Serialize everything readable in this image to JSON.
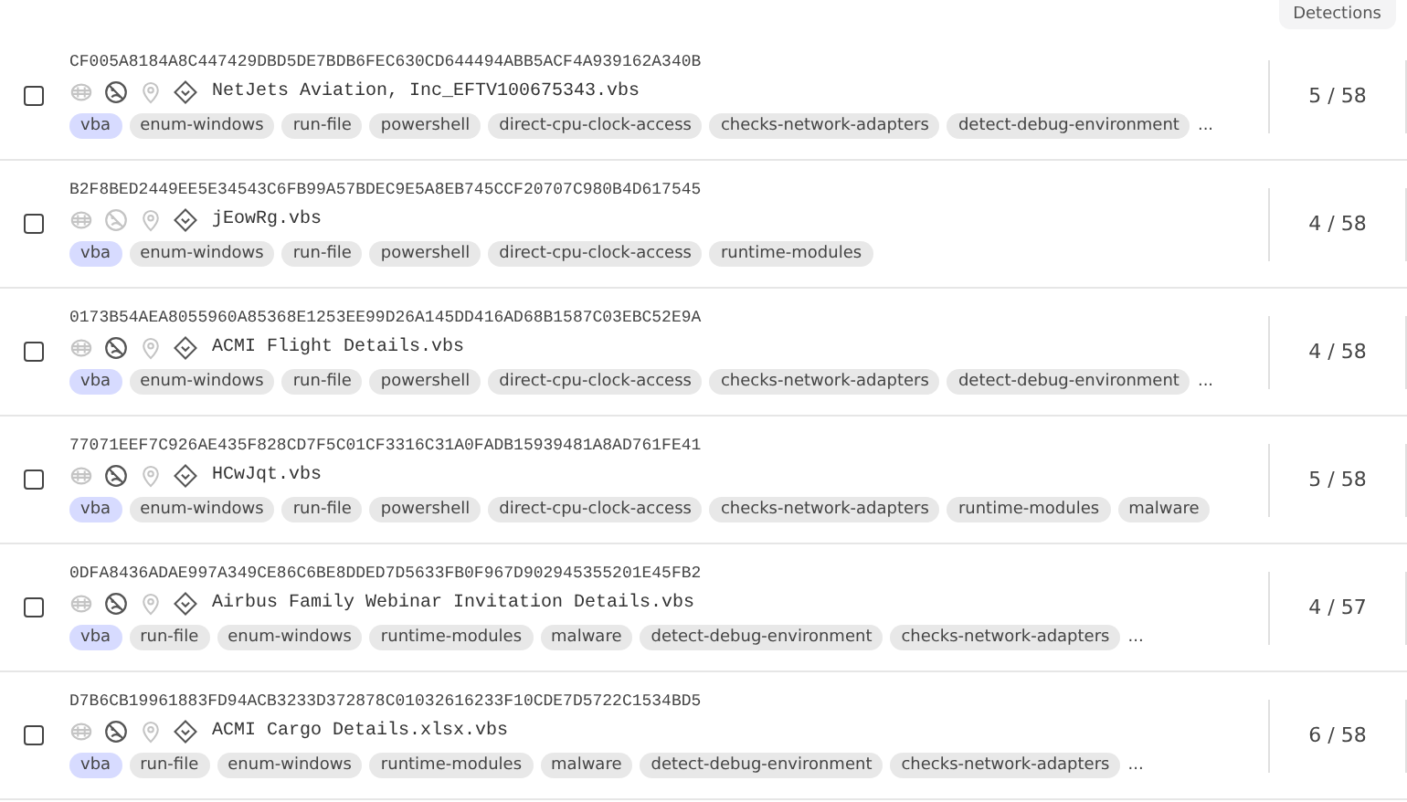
{
  "header": {
    "detections_label": "Detections"
  },
  "rows": [
    {
      "selected": false,
      "hash": "CF005A8184A8C447429DBD5DE7BDB6FEC630CD644494ABB5ACF4A939162A340B",
      "indicators": [
        {
          "kind": "embed",
          "on": false
        },
        {
          "kind": "face",
          "on": true
        },
        {
          "kind": "pin",
          "on": false
        },
        {
          "kind": "diamond",
          "on": true
        }
      ],
      "name": "NetJets Aviation, Inc_EFTV100675343.vbs",
      "tags": [
        {
          "label": "vba",
          "kind": "language"
        },
        {
          "label": "enum-windows",
          "kind": "tag"
        },
        {
          "label": "run-file",
          "kind": "tag"
        },
        {
          "label": "powershell",
          "kind": "tag"
        },
        {
          "label": "direct-cpu-clock-access",
          "kind": "tag"
        },
        {
          "label": "checks-network-adapters",
          "kind": "tag"
        },
        {
          "label": "detect-debug-environment",
          "kind": "tag"
        }
      ],
      "more": "...",
      "detections": "5 / 58"
    },
    {
      "selected": false,
      "hash": "B2F8BED2449EE5E34543C6FB99A57BDEC9E5A8EB745CCF20707C980B4D617545",
      "indicators": [
        {
          "kind": "embed",
          "on": false
        },
        {
          "kind": "face",
          "on": false
        },
        {
          "kind": "pin",
          "on": false
        },
        {
          "kind": "diamond",
          "on": true
        }
      ],
      "name": "jEowRg.vbs",
      "tags": [
        {
          "label": "vba",
          "kind": "language"
        },
        {
          "label": "enum-windows",
          "kind": "tag"
        },
        {
          "label": "run-file",
          "kind": "tag"
        },
        {
          "label": "powershell",
          "kind": "tag"
        },
        {
          "label": "direct-cpu-clock-access",
          "kind": "tag"
        },
        {
          "label": "runtime-modules",
          "kind": "tag"
        }
      ],
      "detections": "4 / 58"
    },
    {
      "selected": false,
      "hash": "0173B54AEA8055960A85368E1253EE99D26A145DD416AD68B1587C03EBC52E9A",
      "indicators": [
        {
          "kind": "embed",
          "on": false
        },
        {
          "kind": "face",
          "on": true
        },
        {
          "kind": "pin",
          "on": false
        },
        {
          "kind": "diamond",
          "on": true
        }
      ],
      "name": "ACMI Flight Details.vbs",
      "tags": [
        {
          "label": "vba",
          "kind": "language"
        },
        {
          "label": "enum-windows",
          "kind": "tag"
        },
        {
          "label": "run-file",
          "kind": "tag"
        },
        {
          "label": "powershell",
          "kind": "tag"
        },
        {
          "label": "direct-cpu-clock-access",
          "kind": "tag"
        },
        {
          "label": "checks-network-adapters",
          "kind": "tag"
        },
        {
          "label": "detect-debug-environment",
          "kind": "tag"
        }
      ],
      "more": "...",
      "detections": "4 / 58"
    },
    {
      "selected": false,
      "hash": "77071EEF7C926AE435F828CD7F5C01CF3316C31A0FADB15939481A8AD761FE41",
      "indicators": [
        {
          "kind": "embed",
          "on": false
        },
        {
          "kind": "face",
          "on": true
        },
        {
          "kind": "pin",
          "on": false
        },
        {
          "kind": "diamond",
          "on": true
        }
      ],
      "name": "HCwJqt.vbs",
      "tags": [
        {
          "label": "vba",
          "kind": "language"
        },
        {
          "label": "enum-windows",
          "kind": "tag"
        },
        {
          "label": "run-file",
          "kind": "tag"
        },
        {
          "label": "powershell",
          "kind": "tag"
        },
        {
          "label": "direct-cpu-clock-access",
          "kind": "tag"
        },
        {
          "label": "checks-network-adapters",
          "kind": "tag"
        },
        {
          "label": "runtime-modules",
          "kind": "tag"
        },
        {
          "label": "malware",
          "kind": "tag"
        }
      ],
      "detections": "5 / 58"
    },
    {
      "selected": false,
      "hash": "0DFA8436ADAE997A349CE86C6BE8DDED7D5633FB0F967D902945355201E45FB2",
      "indicators": [
        {
          "kind": "embed",
          "on": false
        },
        {
          "kind": "face",
          "on": true
        },
        {
          "kind": "pin",
          "on": false
        },
        {
          "kind": "diamond",
          "on": true
        }
      ],
      "name": "Airbus Family Webinar Invitation Details.vbs",
      "tags": [
        {
          "label": "vba",
          "kind": "language"
        },
        {
          "label": "run-file",
          "kind": "tag"
        },
        {
          "label": "enum-windows",
          "kind": "tag"
        },
        {
          "label": "runtime-modules",
          "kind": "tag"
        },
        {
          "label": "malware",
          "kind": "tag"
        },
        {
          "label": "detect-debug-environment",
          "kind": "tag"
        },
        {
          "label": "checks-network-adapters",
          "kind": "tag"
        }
      ],
      "more": "...",
      "detections": "4 / 57"
    },
    {
      "selected": false,
      "hash": "D7B6CB19961883FD94ACB3233D372878C01032616233F10CDE7D5722C1534BD5",
      "indicators": [
        {
          "kind": "embed",
          "on": false
        },
        {
          "kind": "face",
          "on": true
        },
        {
          "kind": "pin",
          "on": false
        },
        {
          "kind": "diamond",
          "on": true
        }
      ],
      "name": "ACMI Cargo Details.xlsx.vbs",
      "tags": [
        {
          "label": "vba",
          "kind": "language"
        },
        {
          "label": "run-file",
          "kind": "tag"
        },
        {
          "label": "enum-windows",
          "kind": "tag"
        },
        {
          "label": "runtime-modules",
          "kind": "tag"
        },
        {
          "label": "malware",
          "kind": "tag"
        },
        {
          "label": "detect-debug-environment",
          "kind": "tag"
        },
        {
          "label": "checks-network-adapters",
          "kind": "tag"
        }
      ],
      "more": "...",
      "detections": "6 / 58"
    }
  ]
}
